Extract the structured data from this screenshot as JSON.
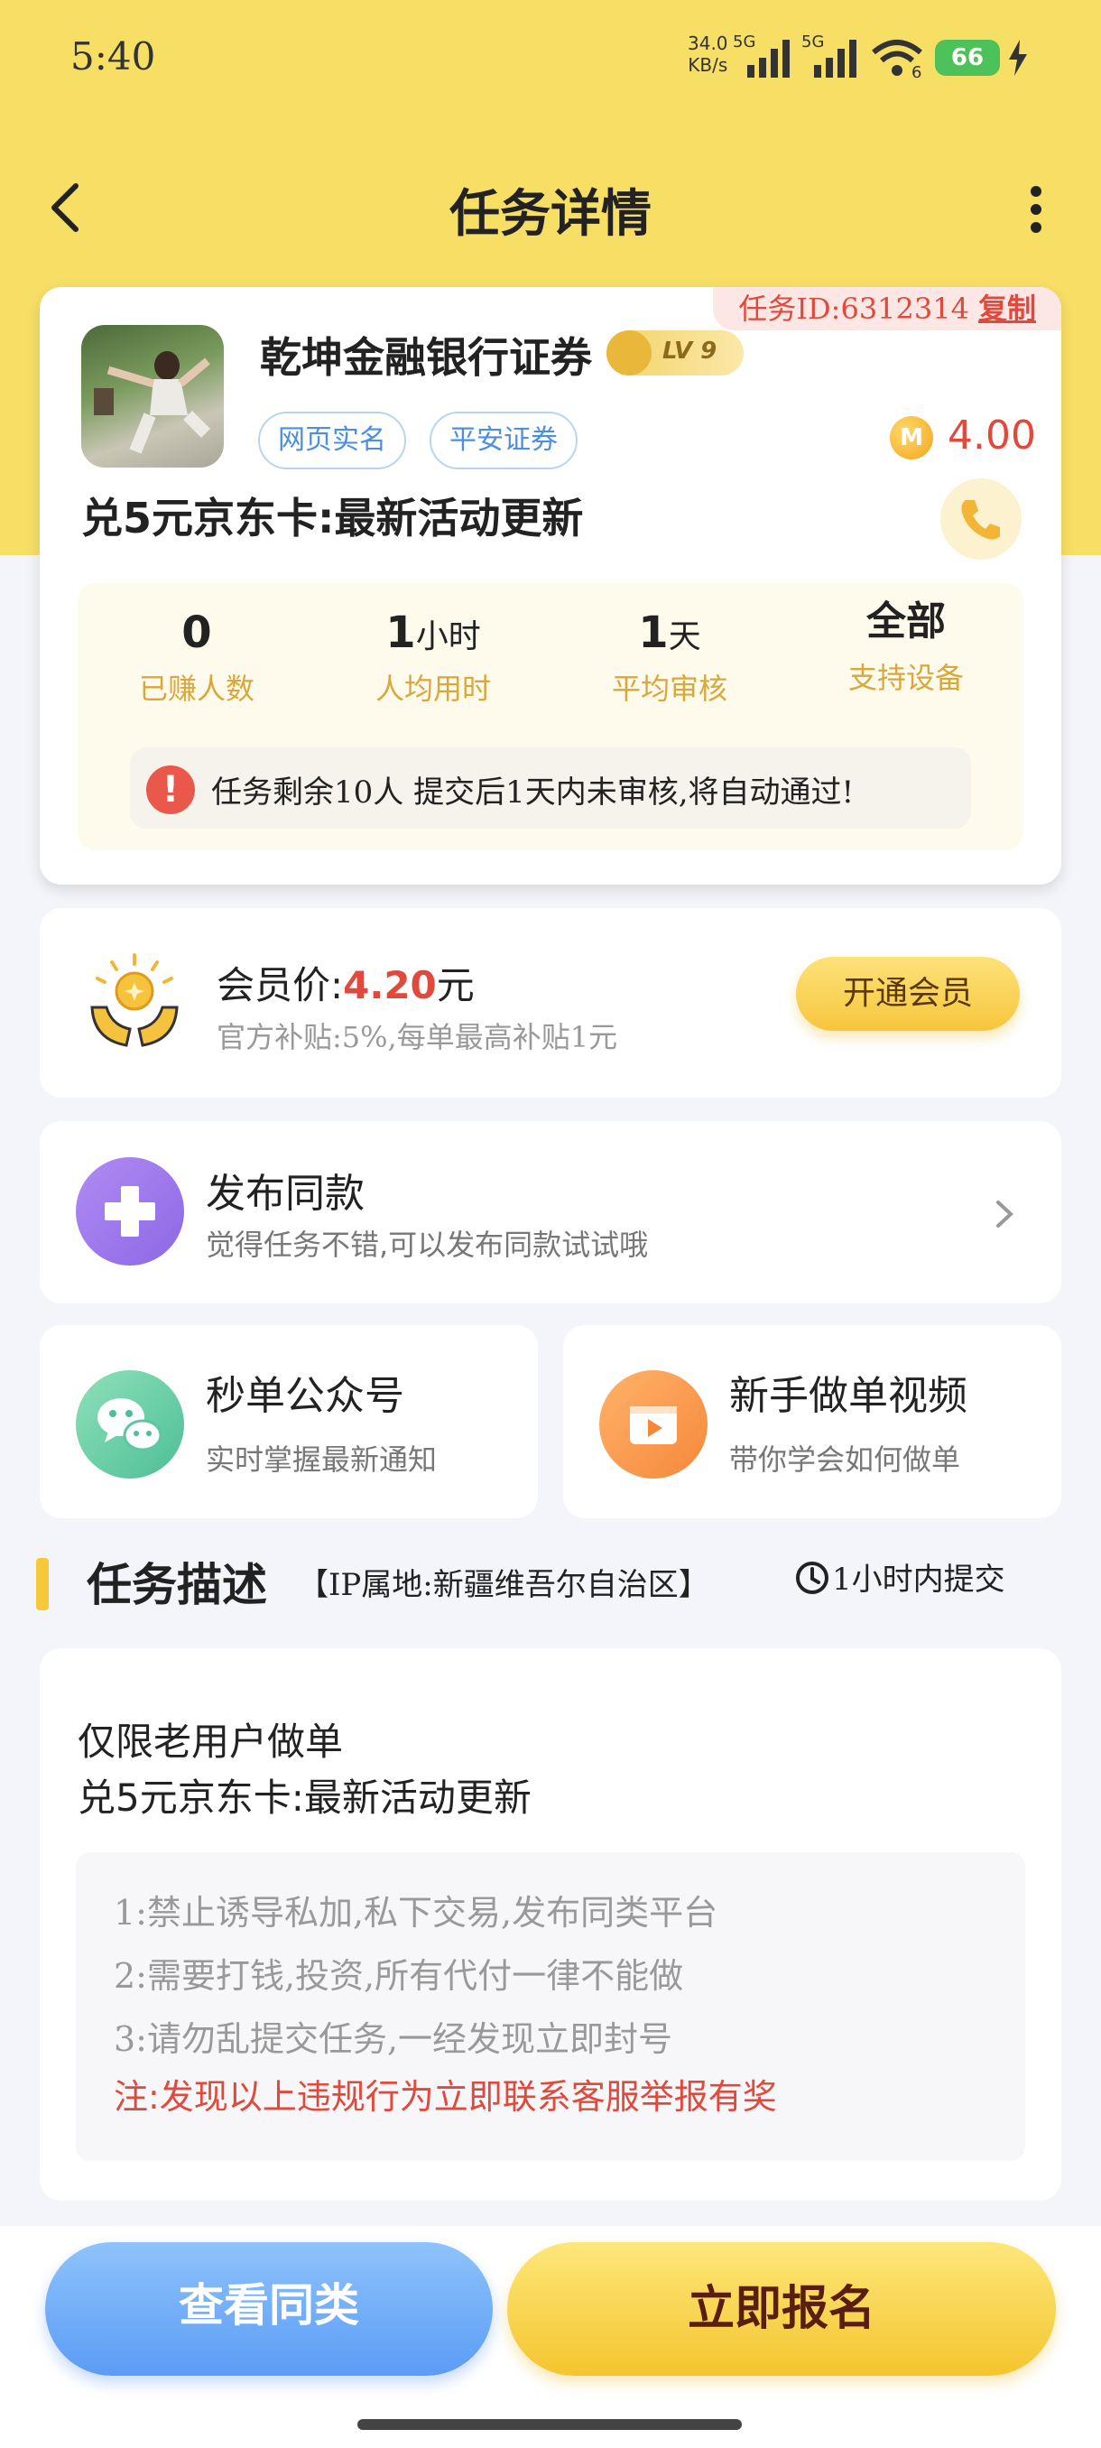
{
  "status_bar": {
    "time": "5:40",
    "net_speed_value": "34.0",
    "net_speed_unit": "KB/s",
    "sim1_label": "5G",
    "sim2_label": "5G",
    "wifi_label": "6",
    "battery": "66"
  },
  "header": {
    "title": "任务详情"
  },
  "task": {
    "id_label": "任务ID:6312314",
    "copy_label": "复制",
    "company": "乾坤金融银行证券",
    "level": "LV 9",
    "tags": [
      "网页实名",
      "平安证券"
    ],
    "coin_symbol": "M",
    "price": "4.00",
    "title": "兑5元京东卡:最新活动更新",
    "stats": [
      {
        "value": "0",
        "unit": "",
        "label": "已赚人数"
      },
      {
        "value": "1",
        "unit": "小时",
        "label": "人均用时"
      },
      {
        "value": "1",
        "unit": "天",
        "label": "平均审核"
      },
      {
        "value": "全部",
        "unit": "",
        "label": "支持设备"
      }
    ],
    "notice": "任务剩余10人  提交后1天内未审核,将自动通过!"
  },
  "member": {
    "label": "会员价:",
    "price": "4.20",
    "currency": "元",
    "subsidy": "官方补贴:5%,每单最高补贴1元",
    "button": "开通会员"
  },
  "publish": {
    "title": "发布同款",
    "subtitle": "觉得任务不错,可以发布同款试试哦"
  },
  "wechat": {
    "title": "秒单公众号",
    "subtitle": "实时掌握最新通知"
  },
  "video": {
    "title": "新手做单视频",
    "subtitle": "带你学会如何做单"
  },
  "description": {
    "section_title": "任务描述",
    "ip_location": "【IP属地:新疆维吾尔自治区】",
    "time_limit": "1小时内提交",
    "lines": [
      "仅限老用户做单",
      "兑5元京东卡:最新活动更新"
    ],
    "rules": [
      "1:禁止诱导私加,私下交易,发布同类平台",
      "2:需要打钱,投资,所有代付一律不能做",
      "3:请勿乱提交任务,一经发现立即封号"
    ],
    "warning": "注:发现以上违规行为立即联系客服举报有奖"
  },
  "bottom": {
    "view_similar": "查看同类",
    "sign_up": "立即报名"
  },
  "colors": {
    "header_bg": "#f7df66",
    "accent_red": "#e0493c",
    "accent_gold": "#d9a73a",
    "primary_blue": "#5b9cf5"
  }
}
